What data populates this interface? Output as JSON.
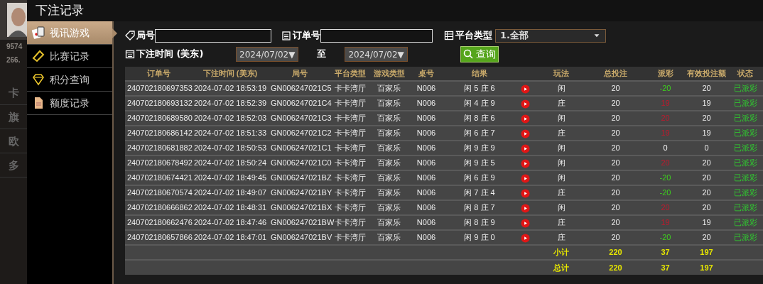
{
  "background_page": {
    "balances": [
      "9574",
      "266."
    ],
    "items": [
      "卡",
      "旗",
      "欧",
      "多"
    ]
  },
  "window": {
    "title": "下注记录"
  },
  "menu": [
    {
      "label": "视讯游戏",
      "selected": true
    },
    {
      "label": "比赛记录",
      "selected": false
    },
    {
      "label": "积分查询",
      "selected": false
    },
    {
      "label": "额度记录",
      "selected": false
    }
  ],
  "filters": {
    "round_label": "局号",
    "order_label": "订单号",
    "platform_label": "平台类型",
    "platform_value": "1.全部",
    "time_label": "下注时间 (美东)",
    "date_from": "2024/07/02▼",
    "to_label": "至",
    "date_to": "2024/07/02▼",
    "search_button": "查询"
  },
  "table": {
    "columns": [
      "订单号",
      "下注时间 (美东)",
      "局号",
      "平台类型",
      "游戏类型",
      "桌号",
      "结果",
      "",
      "玩法",
      "总投注",
      "派彩",
      "有效投注额",
      "状态"
    ],
    "rows": [
      {
        "order": "240702180697353",
        "time": "2024-07-02 18:53:19",
        "round": "GN006247021C5",
        "platform": "卡卡湾厅",
        "game": "百家乐",
        "table": "N006",
        "result": "闲 5 庄 6",
        "play": "闲",
        "bet": "20",
        "payout": {
          "text": "-20",
          "color": "#3ecf1e"
        },
        "valid": "20",
        "status": "已派彩"
      },
      {
        "order": "240702180693132",
        "time": "2024-07-02 18:52:39",
        "round": "GN006247021C4",
        "platform": "卡卡湾厅",
        "game": "百家乐",
        "table": "N006",
        "result": "闲 4 庄 9",
        "play": "庄",
        "bet": "20",
        "payout": {
          "text": "19",
          "color": "#c0182c"
        },
        "valid": "19",
        "status": "已派彩"
      },
      {
        "order": "240702180689580",
        "time": "2024-07-02 18:52:03",
        "round": "GN006247021C3",
        "platform": "卡卡湾厅",
        "game": "百家乐",
        "table": "N006",
        "result": "闲 8 庄 6",
        "play": "闲",
        "bet": "20",
        "payout": {
          "text": "20",
          "color": "#c0182c"
        },
        "valid": "20",
        "status": "已派彩"
      },
      {
        "order": "240702180686142",
        "time": "2024-07-02 18:51:33",
        "round": "GN006247021C2",
        "platform": "卡卡湾厅",
        "game": "百家乐",
        "table": "N006",
        "result": "闲 6 庄 7",
        "play": "庄",
        "bet": "20",
        "payout": {
          "text": "19",
          "color": "#c0182c"
        },
        "valid": "19",
        "status": "已派彩"
      },
      {
        "order": "240702180681882",
        "time": "2024-07-02 18:50:53",
        "round": "GN006247021C1",
        "platform": "卡卡湾厅",
        "game": "百家乐",
        "table": "N006",
        "result": "闲 9 庄 9",
        "play": "闲",
        "bet": "20",
        "payout": {
          "text": "0",
          "color": "#ffffff"
        },
        "valid": "0",
        "status": "已派彩"
      },
      {
        "order": "240702180678492",
        "time": "2024-07-02 18:50:24",
        "round": "GN006247021C0",
        "platform": "卡卡湾厅",
        "game": "百家乐",
        "table": "N006",
        "result": "闲 9 庄 5",
        "play": "闲",
        "bet": "20",
        "payout": {
          "text": "20",
          "color": "#c0182c"
        },
        "valid": "20",
        "status": "已派彩"
      },
      {
        "order": "240702180674421",
        "time": "2024-07-02 18:49:45",
        "round": "GN006247021BZ",
        "platform": "卡卡湾厅",
        "game": "百家乐",
        "table": "N006",
        "result": "闲 6 庄 9",
        "play": "闲",
        "bet": "20",
        "payout": {
          "text": "-20",
          "color": "#3ecf1e"
        },
        "valid": "20",
        "status": "已派彩"
      },
      {
        "order": "240702180670574",
        "time": "2024-07-02 18:49:07",
        "round": "GN006247021BY",
        "platform": "卡卡湾厅",
        "game": "百家乐",
        "table": "N006",
        "result": "闲 7 庄 4",
        "play": "庄",
        "bet": "20",
        "payout": {
          "text": "-20",
          "color": "#3ecf1e"
        },
        "valid": "20",
        "status": "已派彩"
      },
      {
        "order": "240702180666862",
        "time": "2024-07-02 18:48:31",
        "round": "GN006247021BX",
        "platform": "卡卡湾厅",
        "game": "百家乐",
        "table": "N006",
        "result": "闲 8 庄 7",
        "play": "闲",
        "bet": "20",
        "payout": {
          "text": "20",
          "color": "#c0182c"
        },
        "valid": "20",
        "status": "已派彩"
      },
      {
        "order": "240702180662476",
        "time": "2024-07-02 18:47:46",
        "round": "GN006247021BW",
        "platform": "卡卡湾厅",
        "game": "百家乐",
        "table": "N006",
        "result": "闲 8 庄 9",
        "play": "庄",
        "bet": "20",
        "payout": {
          "text": "19",
          "color": "#c0182c"
        },
        "valid": "19",
        "status": "已派彩"
      },
      {
        "order": "240702180657866",
        "time": "2024-07-02 18:47:01",
        "round": "GN006247021BV",
        "platform": "卡卡湾厅",
        "game": "百家乐",
        "table": "N006",
        "result": "闲 9 庄 0",
        "play": "庄",
        "bet": "20",
        "payout": {
          "text": "-20",
          "color": "#3ecf1e"
        },
        "valid": "20",
        "status": "已派彩"
      }
    ],
    "summary": [
      {
        "label": "小计",
        "bet": "220",
        "payout": "37",
        "valid": "197"
      },
      {
        "label": "总计",
        "bet": "220",
        "payout": "37",
        "valid": "197"
      }
    ]
  }
}
